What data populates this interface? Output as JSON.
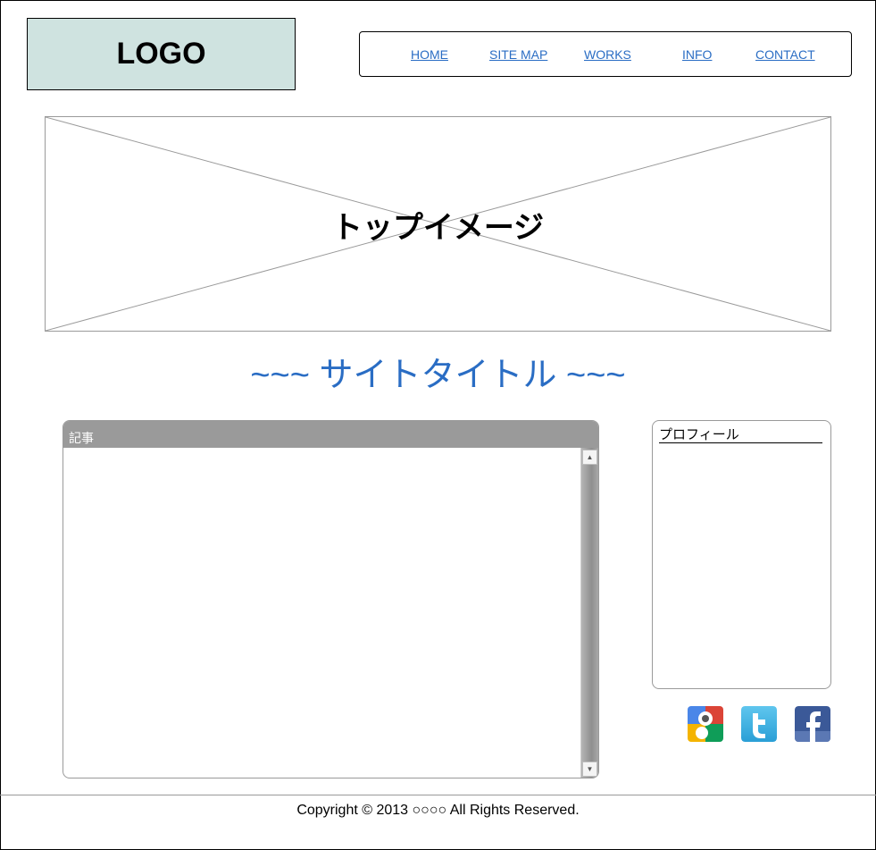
{
  "header": {
    "logo_text": "LOGO"
  },
  "nav": {
    "items": [
      {
        "label": "HOME"
      },
      {
        "label": "SITE MAP"
      },
      {
        "label": "WORKS"
      },
      {
        "label": "INFO"
      },
      {
        "label": "CONTACT"
      }
    ],
    "link_color": "#2a6dc4"
  },
  "hero": {
    "text": "トップイメージ"
  },
  "site_title": "~~~ サイトタイトル ~~~",
  "article": {
    "header": "記事",
    "header_color": "#9a9a9a"
  },
  "profile": {
    "title": "プロフィール"
  },
  "social": [
    {
      "name": "google-plus-icon"
    },
    {
      "name": "twitter-icon"
    },
    {
      "name": "facebook-icon"
    }
  ],
  "footer": {
    "copyright": "Copyright © 2013 ○○○○ All Rights Reserved."
  },
  "colors": {
    "logo_bg": "#cfe3e0",
    "accent": "#2a6dc4"
  }
}
